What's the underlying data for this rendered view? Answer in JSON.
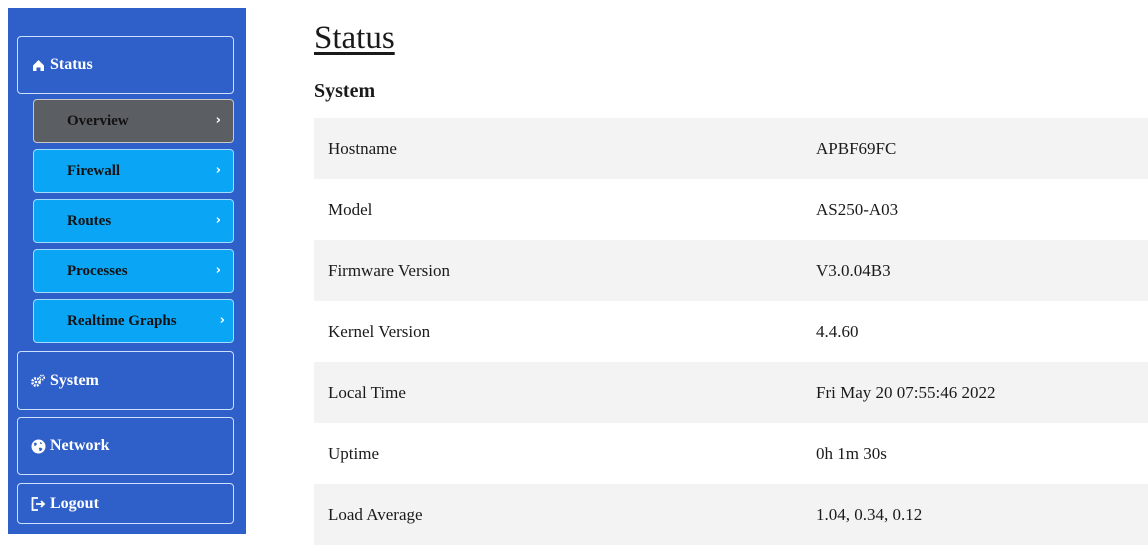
{
  "sidebar": {
    "status": {
      "label": "Status",
      "icon": "home-icon"
    },
    "sub_items": [
      {
        "label": "Overview",
        "active": true
      },
      {
        "label": "Firewall",
        "active": false
      },
      {
        "label": "Routes",
        "active": false
      },
      {
        "label": "Processes",
        "active": false
      },
      {
        "label": "Realtime Graphs",
        "active": false
      }
    ],
    "system": {
      "label": "System",
      "icon": "gears-icon"
    },
    "network": {
      "label": "Network",
      "icon": "globe-icon"
    },
    "logout": {
      "label": "Logout",
      "icon": "logout-icon"
    }
  },
  "main": {
    "title": "Status",
    "section": "System",
    "rows": [
      {
        "key": "Hostname",
        "value": "APBF69FC"
      },
      {
        "key": "Model",
        "value": "AS250-A03"
      },
      {
        "key": "Firmware Version",
        "value": "V3.0.04B3"
      },
      {
        "key": "Kernel Version",
        "value": "4.4.60"
      },
      {
        "key": "Local Time",
        "value": "Fri May 20 07:55:46 2022"
      },
      {
        "key": "Uptime",
        "value": "0h 1m 30s"
      },
      {
        "key": "Load Average",
        "value": "1.04, 0.34, 0.12"
      }
    ]
  },
  "colors": {
    "sidebar_bg": "#2f5fc8",
    "sub_item_bg": "#0aa6f5",
    "active_item_bg": "#5b5e63",
    "row_stripe": "#f3f3f3"
  }
}
